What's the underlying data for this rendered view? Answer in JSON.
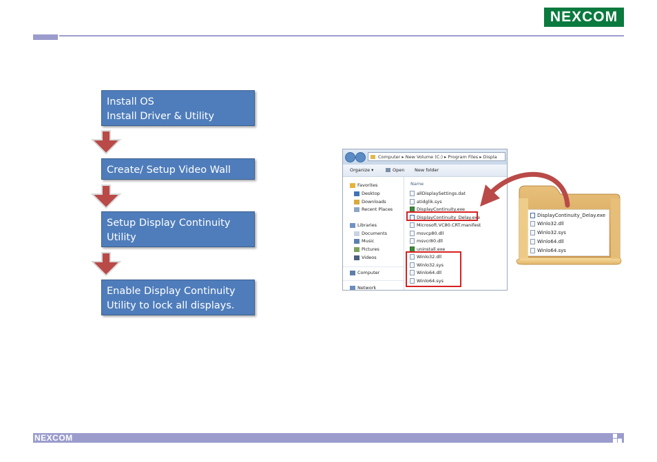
{
  "header": {
    "logo_text": "NEXCOM",
    "accent_color": "#9b9ccc",
    "logo_color": "#0a7a3e"
  },
  "flow": {
    "steps": [
      {
        "lines": [
          "Install OS",
          "Install Driver & Utility"
        ]
      },
      {
        "lines": [
          "Create/ Setup Video Wall"
        ]
      },
      {
        "lines": [
          "Setup Display Continuity",
          "Utility"
        ]
      },
      {
        "lines": [
          "Enable Display Continuity",
          "Utility to lock all displays."
        ]
      }
    ],
    "box_color": "#4f7dbb",
    "arrow_color": "#b94a48"
  },
  "explorer": {
    "address": "Computer ▸ New Volume (C:) ▸ Program Files ▸ Displa",
    "toolbar": {
      "organize": "Organize ▾",
      "open": "Open",
      "new_folder": "New folder"
    },
    "nav": {
      "favorites": "Favorites",
      "desktop": "Desktop",
      "downloads": "Downloads",
      "recent": "Recent Places",
      "libraries": "Libraries",
      "documents": "Documents",
      "music": "Music",
      "pictures": "Pictures",
      "videos": "Videos",
      "computer": "Computer",
      "network": "Network"
    },
    "column_header": "Name",
    "files": [
      "allDisplaySettings.dat",
      "atidglik.sys",
      "DisplayContinuity.exe",
      "DisplayContinuity_Delay.exe",
      "Microsoft.VC80.CRT.manifest",
      "msvcp80.dll",
      "msvcr80.dll",
      "uninstall.exe",
      "Winlo32.dll",
      "Winlo32.sys",
      "Winlo64.dll",
      "Winlo64.sys"
    ]
  },
  "folder": {
    "files": [
      "DisplayContinuity_Delay.exe",
      "Winlo32.dll",
      "Winlo32.sys",
      "Winlo64.dll",
      "Winlo64.sys"
    ]
  },
  "footer": {
    "logo_text": "NEXCOM"
  }
}
